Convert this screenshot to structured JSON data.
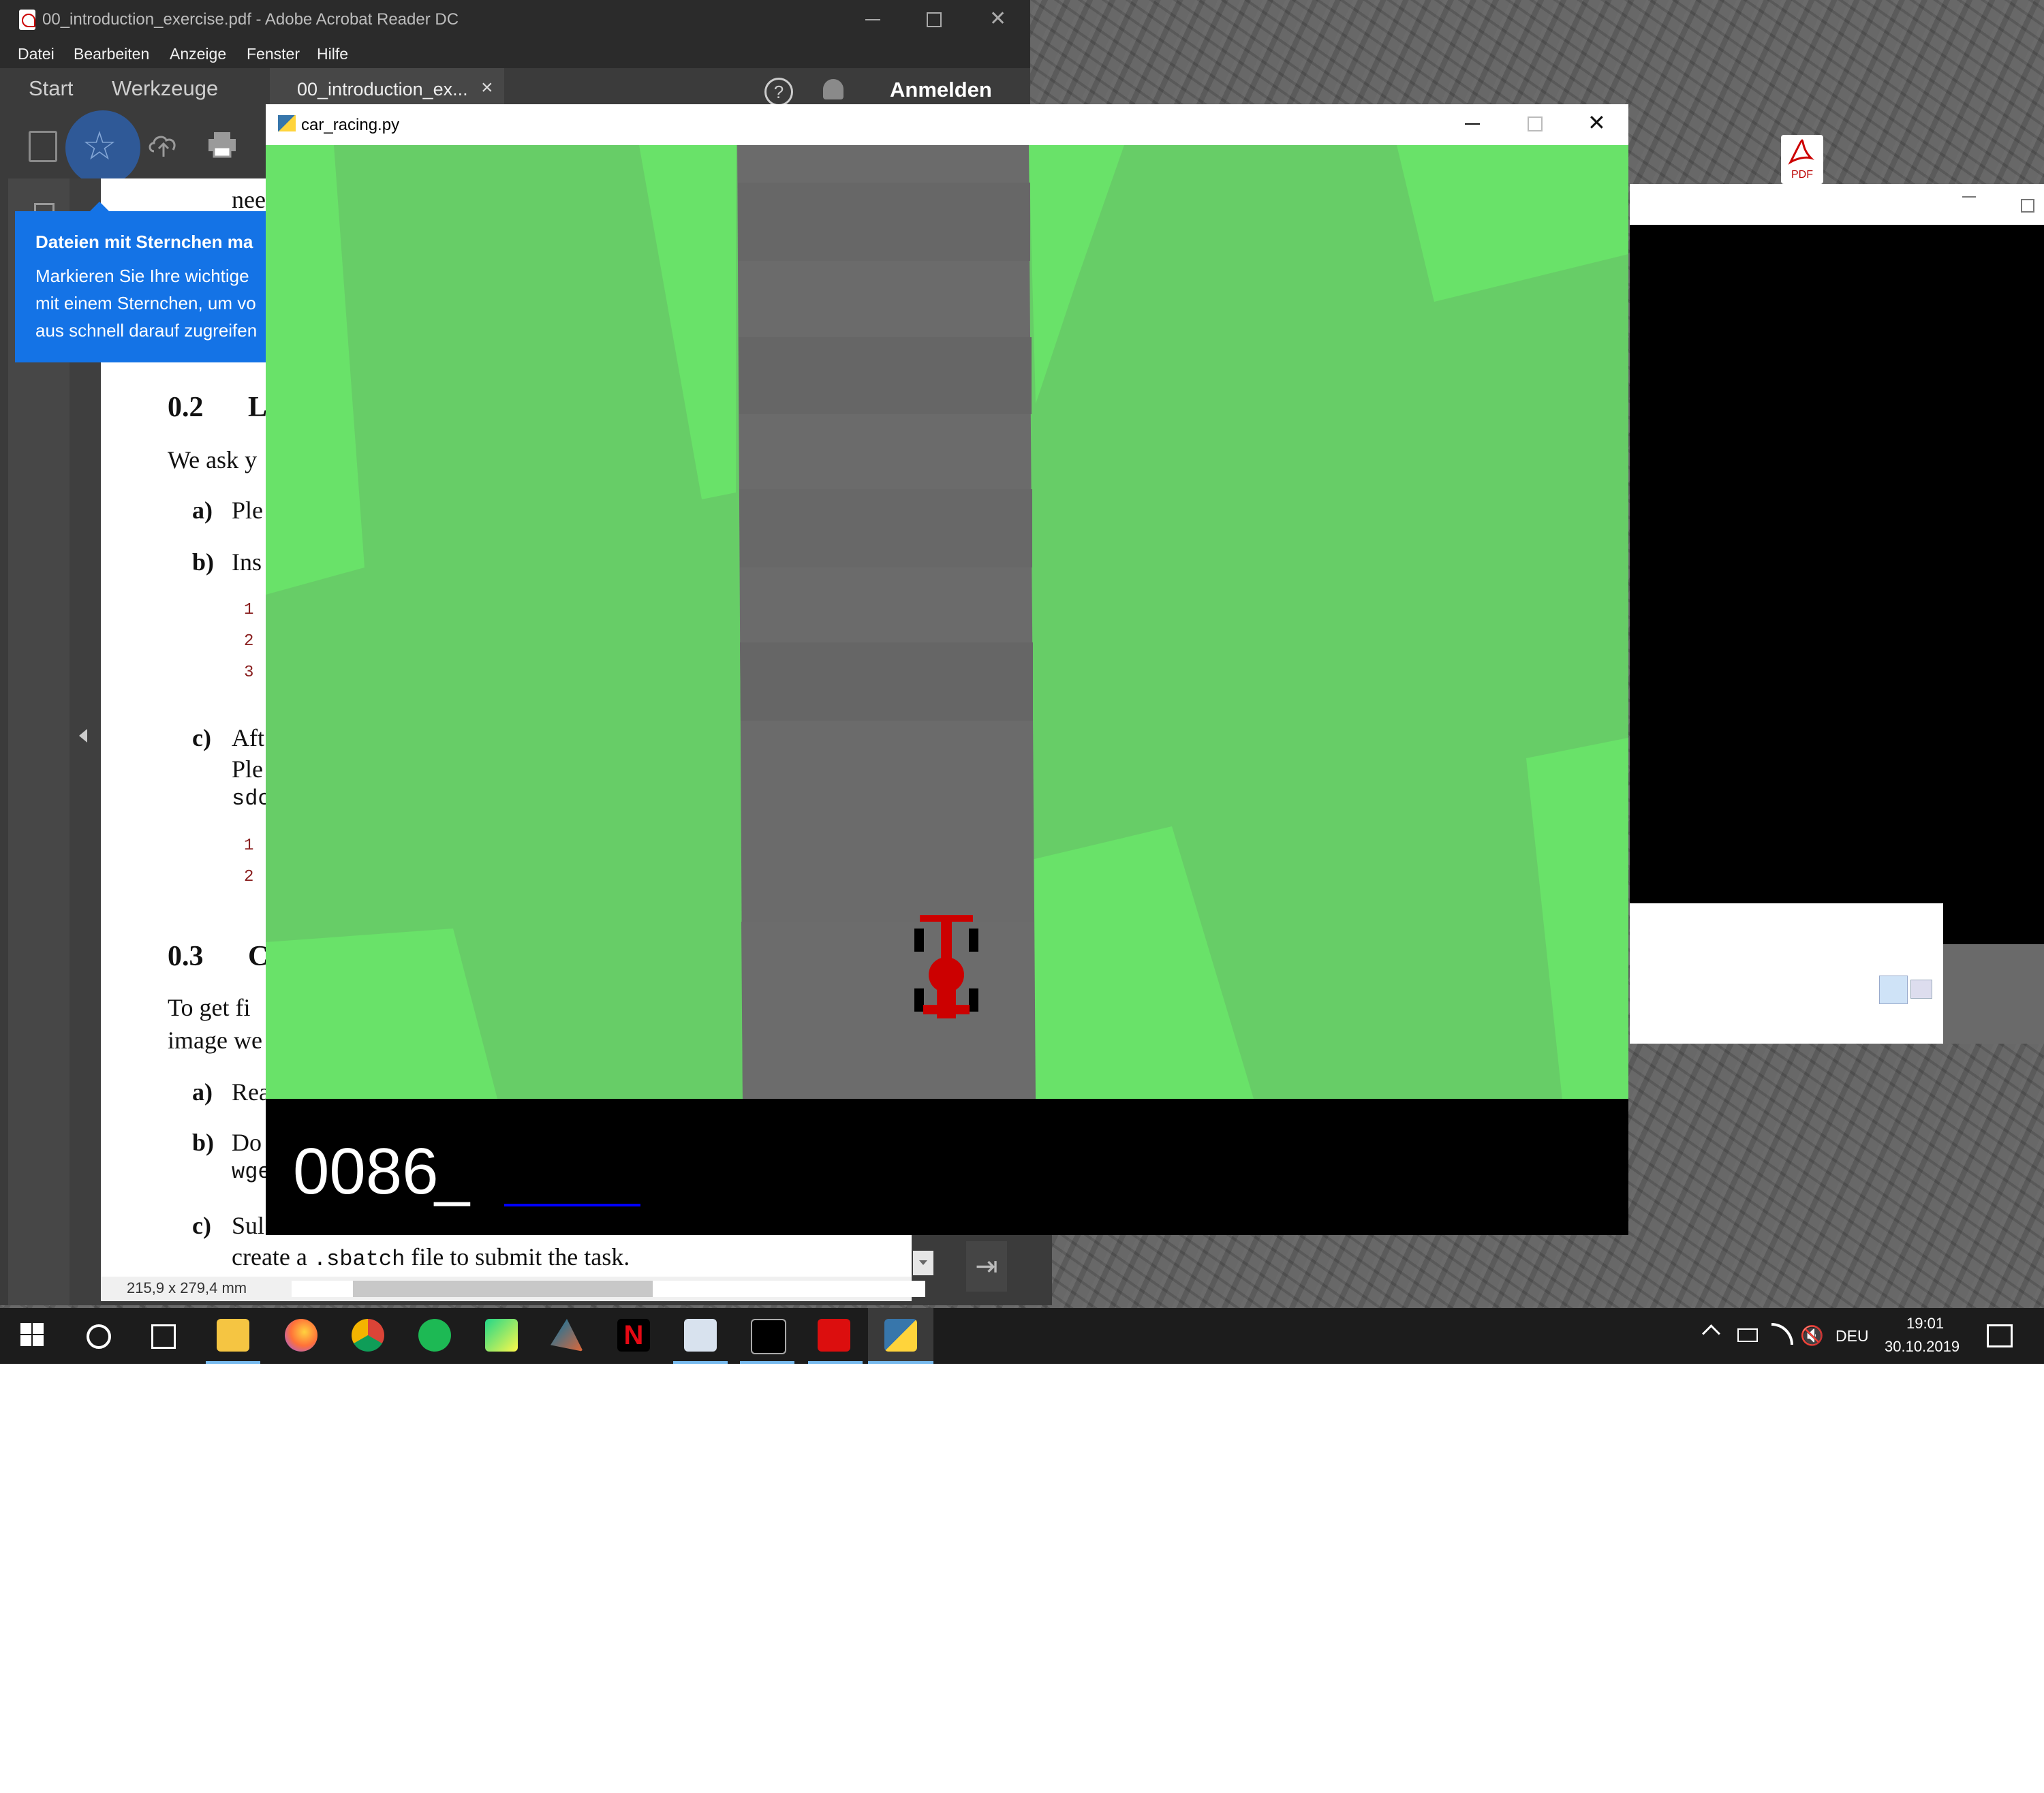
{
  "acrobat": {
    "title": "00_introduction_exercise.pdf - Adobe Acrobat Reader DC",
    "menu": [
      "Datei",
      "Bearbeiten",
      "Anzeige",
      "Fenster",
      "Hilfe"
    ],
    "tab_start": "Start",
    "tab_tools": "Werkzeuge",
    "doc_tab": "00_introduction_ex...",
    "doc_tab_close": "×",
    "help": "?",
    "signin": "Anmelden",
    "tooltip": {
      "title": "Dateien mit Sternchen ma",
      "line1": "Markieren Sie Ihre wichtige",
      "line2": "mit einem Sternchen, um vo",
      "line3": "aus schnell darauf zugreifen"
    },
    "page": {
      "t_nee": "nee",
      "sec02_num": "0.2",
      "sec02_title": "L",
      "we_ask": "We ask y",
      "a1_label": "a)",
      "a1_text": "Ple",
      "b1_label": "b)",
      "b1_text": "Ins",
      "n1": "1",
      "n2": "2",
      "n3": "3",
      "c1_label": "c)",
      "c1_text": "Aft",
      "c1_text2": "Ple",
      "c1_code": "sdc",
      "m1": "1",
      "m2": "2",
      "sec03_num": "0.3",
      "sec03_title": "C",
      "to_get": "To get fi",
      "image_we": "image we",
      "a2_label": "a)",
      "a2_text": "Rea",
      "b2_label": "b)",
      "b2_text": "Do",
      "b2_code": "wge",
      "c2_label": "c)",
      "c2_text": "Sul",
      "last_pre": "create a ",
      "last_code": ".sbatch",
      "last_post": " file to submit the task."
    },
    "page_size": "215,9 x 279,4 mm"
  },
  "game": {
    "title": "car_racing.py",
    "score": "0086",
    "score_cursor": "_"
  },
  "desktop": {
    "pdf_icon_label": "PDF"
  },
  "taskbar": {
    "language": "DEU",
    "time": "19:01",
    "date": "30.10.2019",
    "apps": [
      "file-explorer",
      "firefox",
      "chrome",
      "spotify",
      "pycharm",
      "matlab",
      "netflix",
      "task-manager",
      "terminal",
      "acrobat",
      "python"
    ]
  },
  "colors": {
    "grass_dark": "#67cd67",
    "grass_light": "#69e269",
    "road": "#6b6b6b",
    "car": "#cc0000",
    "acrobat_blue": "#1473e6"
  }
}
